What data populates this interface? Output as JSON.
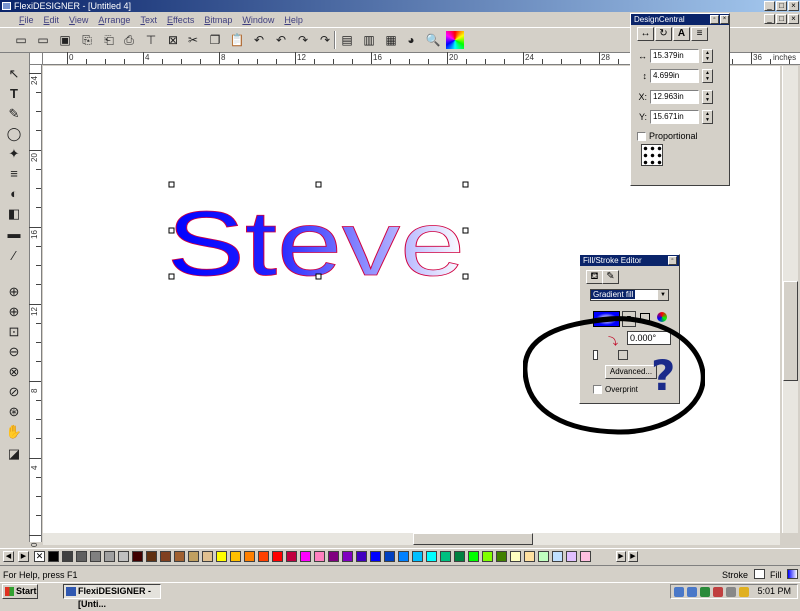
{
  "window": {
    "title": "FlexiDESIGNER - [Untitled 4]",
    "controls": [
      "_",
      "□",
      "×"
    ]
  },
  "menu": [
    "File",
    "Edit",
    "View",
    "Arrange",
    "Text",
    "Effects",
    "Bitmap",
    "Window",
    "Help"
  ],
  "toolbar_icons": [
    "new-icon",
    "open-icon",
    "save-icon",
    "import-icon",
    "export-icon",
    "print-icon",
    "plot-icon",
    "cut-icon",
    "copy-icon",
    "paste-icon",
    "undo-icon",
    "redo-icon",
    "repeat-icon",
    "redo-multiple-icon",
    "design-central-icon",
    "fill-stroke-icon",
    "color-wheel-icon",
    "zoom-icon",
    "color-palette-icon"
  ],
  "ruler": {
    "horizontal_labels": [
      "0",
      "4",
      "8",
      "12",
      "16",
      "20",
      "24",
      "28",
      "32",
      "36"
    ],
    "units": "inches",
    "vertical_labels": [
      "24",
      "20",
      "16",
      "12",
      "8",
      "4",
      "0"
    ]
  },
  "canvas": {
    "text": "Steve"
  },
  "design_central": {
    "title": "DesignCentral",
    "tabs": [
      "↔",
      "↻",
      "A",
      "≡"
    ],
    "width_value": "15.379in",
    "height_value": "4.699in",
    "x_label": "X:",
    "x_value": "12.963in",
    "y_label": "Y:",
    "y_value": "15.671in",
    "proportional_label": "Proportional"
  },
  "fill_stroke": {
    "title": "Fill/Stroke Editor",
    "fill_type": "Gradient fill",
    "angle_value": "0.000°",
    "advanced_label": "Advanced...",
    "overprint_label": "Overprint",
    "annotation": "?"
  },
  "status": {
    "help_text": "For Help, press F1",
    "stroke_label": "Stroke",
    "fill_label": "Fill"
  },
  "taskbar": {
    "start_label": "Start",
    "task_label": "FlexiDESIGNER - [Unti...",
    "clock": "5:01 PM"
  },
  "palette_colors": [
    "#000000",
    "#404040",
    "#606060",
    "#808080",
    "#a0a0a0",
    "#c0c0c0",
    "#400000",
    "#603010",
    "#804020",
    "#a06030",
    "#c0a060",
    "#e0c090",
    "#ffff00",
    "#ffc000",
    "#ff8000",
    "#ff4000",
    "#ff0000",
    "#c00040",
    "#ff00ff",
    "#ff80c0",
    "#800080",
    "#8000c0",
    "#4000c0",
    "#0000ff",
    "#0040c0",
    "#0080ff",
    "#00c0ff",
    "#00ffff",
    "#00c080",
    "#008040",
    "#00ff00",
    "#80ff00",
    "#408000",
    "#ffffc0",
    "#ffe0a0",
    "#c0ffc0",
    "#c0e0ff",
    "#e0c0ff",
    "#ffc0e0"
  ]
}
